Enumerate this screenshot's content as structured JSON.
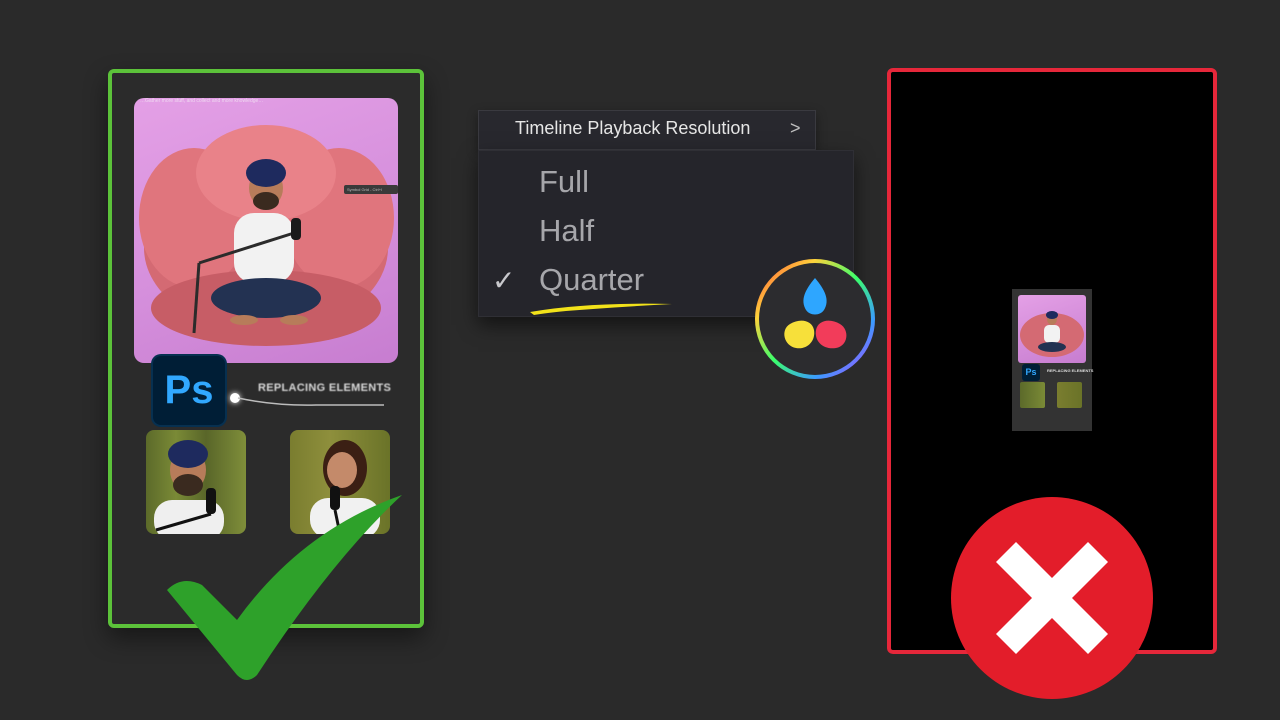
{
  "menu": {
    "header_label": "Timeline Playback Resolution",
    "chevron": ">",
    "items": [
      {
        "label": "Full",
        "selected": false
      },
      {
        "label": "Half",
        "selected": false
      },
      {
        "label": "Quarter",
        "selected": true
      }
    ],
    "check_glyph": "✓",
    "underline_color": "#f2e21a"
  },
  "left_panel": {
    "status": "good",
    "frame_color": "#5cc23a",
    "caption_text": "…Gather more stuff, and collect and more knowledge…",
    "mini_toolbar_text": "Symbol Grid - Ctrl+I",
    "ps_icon_text": "Ps",
    "overlay_label": "REPLACING ELEMENTS",
    "check_color": "#2ea12a"
  },
  "right_panel": {
    "status": "bad",
    "frame_color": "#e6273a",
    "ps_icon_text": "Ps",
    "overlay_label": "REPLACING ELEMENTS",
    "x_color": "#e31d2a"
  },
  "resolve_logo": {
    "icon": "davinci-resolve-icon",
    "colors": [
      "#2ea6ff",
      "#f7e03a",
      "#f23c5a"
    ]
  }
}
